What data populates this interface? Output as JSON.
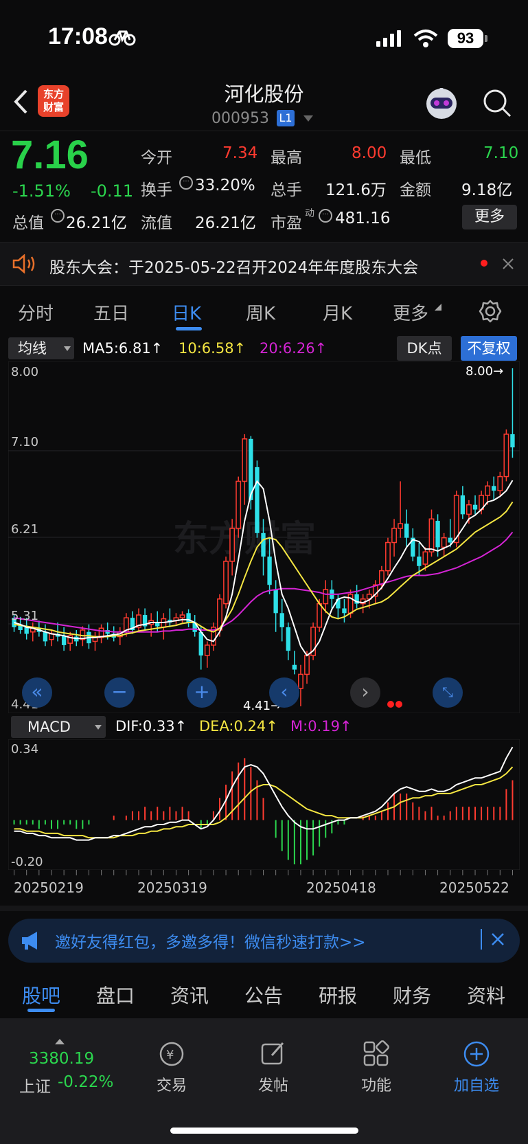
{
  "status": {
    "time": "17:08",
    "battery": "93"
  },
  "header": {
    "logo_text": "东方财富",
    "title": "河化股份",
    "code": "000953",
    "level": "L1"
  },
  "quote": {
    "price": "7.16",
    "change_pct": "-1.51%",
    "change": "-0.11",
    "open_label": "今开",
    "open": "7.34",
    "high_label": "最高",
    "high": "8.00",
    "low_label": "最低",
    "low": "7.10",
    "turnover_label": "换手",
    "turnover": "33.20%",
    "volume_label": "总手",
    "volume": "121.6万",
    "amount_label": "金额",
    "amount": "9.18亿",
    "mktcap_label": "总值",
    "mktcap": "26.21亿",
    "float_label": "流值",
    "float": "26.21亿",
    "pe_label": "市盈",
    "pe_sup": "动",
    "pe": "481.16",
    "more_label": "更多"
  },
  "notice": {
    "text": "股东大会：于2025-05-22召开2024年年度股东大会"
  },
  "chart_tabs": [
    "分时",
    "五日",
    "日K",
    "周K",
    "月K",
    "更多"
  ],
  "active_chart_tab": "日K",
  "ma_bar": {
    "select": "均线",
    "ma5": "MA5:6.81↑",
    "ma10": "10:6.58↑",
    "ma20": "20:6.26↑",
    "dk_label": "DK点",
    "fq_label": "不复权"
  },
  "price_axis": {
    "top": "8.00",
    "l2": "7.10",
    "l3": "6.21",
    "l4": "5.31",
    "bottom": "4.41"
  },
  "annotations": {
    "max": "8.00→",
    "min": "4.41→"
  },
  "watermark": "东方财富",
  "macd_bar": {
    "select": "MACD",
    "dif": "DIF:0.33↑",
    "dea": "DEA:0.24↑",
    "m": "M:0.19↑"
  },
  "macd_axis": {
    "top": "0.34",
    "bottom": "-0.20"
  },
  "dates": [
    "20250219",
    "20250319",
    "20250418",
    "20250522"
  ],
  "invite": {
    "text": "邀好友得红包，多邀多得！微信秒速打款>>"
  },
  "footer_tabs": [
    "股吧",
    "盘口",
    "资讯",
    "公告",
    "研报",
    "财务",
    "资料"
  ],
  "active_footer_tab": "股吧",
  "bottom_nav": {
    "index_value": "3380.19",
    "index_name": "上证",
    "index_change": "-0.22%",
    "trade": "交易",
    "post": "发帖",
    "func": "功能",
    "add": "加自选"
  },
  "colors": {
    "up": "#ff3b30",
    "down": "#2ee0e8",
    "ma5": "#ffffff",
    "ma10": "#f5e642",
    "ma20": "#d424d4",
    "accent": "#2d7fe0"
  },
  "chart_data": {
    "type": "candlestick",
    "ylim": [
      4.41,
      8.0
    ],
    "ohlc": [
      [
        5.35,
        5.38,
        5.2,
        5.25
      ],
      [
        5.28,
        5.36,
        5.18,
        5.22
      ],
      [
        5.25,
        5.35,
        5.12,
        5.18
      ],
      [
        5.2,
        5.3,
        5.1,
        5.24
      ],
      [
        5.24,
        5.32,
        5.15,
        5.2
      ],
      [
        5.2,
        5.28,
        5.05,
        5.1
      ],
      [
        5.12,
        5.22,
        5.05,
        5.18
      ],
      [
        5.18,
        5.3,
        5.1,
        5.15
      ],
      [
        5.16,
        5.25,
        5.0,
        5.06
      ],
      [
        5.08,
        5.2,
        5.0,
        5.16
      ],
      [
        5.15,
        5.22,
        5.05,
        5.1
      ],
      [
        5.12,
        5.26,
        5.05,
        5.22
      ],
      [
        5.2,
        5.28,
        5.02,
        5.08
      ],
      [
        5.1,
        5.2,
        5.0,
        5.15
      ],
      [
        5.14,
        5.28,
        5.08,
        5.24
      ],
      [
        5.22,
        5.3,
        5.12,
        5.18
      ],
      [
        5.18,
        5.26,
        5.1,
        5.14
      ],
      [
        5.15,
        5.25,
        5.06,
        5.2
      ],
      [
        5.2,
        5.4,
        5.15,
        5.35
      ],
      [
        5.35,
        5.42,
        5.18,
        5.22
      ],
      [
        5.25,
        5.45,
        5.2,
        5.38
      ],
      [
        5.38,
        5.45,
        5.22,
        5.26
      ],
      [
        5.28,
        5.4,
        5.15,
        5.32
      ],
      [
        5.3,
        5.42,
        5.2,
        5.26
      ],
      [
        5.25,
        5.4,
        5.12,
        5.34
      ],
      [
        5.33,
        5.45,
        5.25,
        5.3
      ],
      [
        5.32,
        5.4,
        5.28,
        5.35
      ],
      [
        5.35,
        5.42,
        5.3,
        5.38
      ],
      [
        5.4,
        5.44,
        5.25,
        5.3
      ],
      [
        5.3,
        5.38,
        5.15,
        5.2
      ],
      [
        5.2,
        5.26,
        4.8,
        4.95
      ],
      [
        4.95,
        5.1,
        4.82,
        5.06
      ],
      [
        5.06,
        5.3,
        5.0,
        5.25
      ],
      [
        5.22,
        5.6,
        5.15,
        5.55
      ],
      [
        5.5,
        6.0,
        5.45,
        5.95
      ],
      [
        5.95,
        6.4,
        5.8,
        6.3
      ],
      [
        6.3,
        6.85,
        6.2,
        6.8
      ],
      [
        6.8,
        7.3,
        6.55,
        7.25
      ],
      [
        7.25,
        7.28,
        6.5,
        6.6
      ],
      [
        6.95,
        7.02,
        6.2,
        6.25
      ],
      [
        6.25,
        6.4,
        5.8,
        6.0
      ],
      [
        6.0,
        6.2,
        5.6,
        5.7
      ],
      [
        5.65,
        5.75,
        5.2,
        5.4
      ],
      [
        5.4,
        5.55,
        5.1,
        5.25
      ],
      [
        5.25,
        5.3,
        4.9,
        5.0
      ],
      [
        4.85,
        5.0,
        4.75,
        4.8
      ],
      [
        4.6,
        4.85,
        4.41,
        4.75
      ],
      [
        4.75,
        5.0,
        4.65,
        4.95
      ],
      [
        4.95,
        5.3,
        4.9,
        5.25
      ],
      [
        5.25,
        5.55,
        5.2,
        5.5
      ],
      [
        5.5,
        5.75,
        5.4,
        5.65
      ],
      [
        5.65,
        5.75,
        5.45,
        5.55
      ],
      [
        5.55,
        5.6,
        5.35,
        5.45
      ],
      [
        5.45,
        5.55,
        5.3,
        5.4
      ],
      [
        5.4,
        5.65,
        5.35,
        5.6
      ],
      [
        5.6,
        5.7,
        5.45,
        5.5
      ],
      [
        5.5,
        5.6,
        5.4,
        5.55
      ],
      [
        5.55,
        5.65,
        5.45,
        5.6
      ],
      [
        5.58,
        5.75,
        5.5,
        5.7
      ],
      [
        5.7,
        5.9,
        5.65,
        5.85
      ],
      [
        5.85,
        6.2,
        5.8,
        6.15
      ],
      [
        6.15,
        6.4,
        6.0,
        6.3
      ],
      [
        6.3,
        6.8,
        6.2,
        6.35
      ],
      [
        6.35,
        6.5,
        6.1,
        6.2
      ],
      [
        6.2,
        6.3,
        5.95,
        6.0
      ],
      [
        6.0,
        6.15,
        5.8,
        5.9
      ],
      [
        5.92,
        6.1,
        5.85,
        6.05
      ],
      [
        6.05,
        6.5,
        6.0,
        6.4
      ],
      [
        6.38,
        6.45,
        6.0,
        6.1
      ],
      [
        6.1,
        6.25,
        6.0,
        6.2
      ],
      [
        6.2,
        6.4,
        6.1,
        6.15
      ],
      [
        6.15,
        6.7,
        6.1,
        6.65
      ],
      [
        6.65,
        6.75,
        6.4,
        6.45
      ],
      [
        6.45,
        6.6,
        6.35,
        6.55
      ],
      [
        6.55,
        6.65,
        6.45,
        6.5
      ],
      [
        6.5,
        6.7,
        6.45,
        6.65
      ],
      [
        6.65,
        6.8,
        6.55,
        6.75
      ],
      [
        6.75,
        6.85,
        6.6,
        6.7
      ],
      [
        6.7,
        6.9,
        6.65,
        6.85
      ],
      [
        6.85,
        7.35,
        6.8,
        7.3
      ],
      [
        7.3,
        8.0,
        7.05,
        7.16
      ]
    ],
    "ma5": [
      5.3,
      5.28,
      5.25,
      5.24,
      5.22,
      5.2,
      5.18,
      5.17,
      5.16,
      5.14,
      5.13,
      5.13,
      5.14,
      5.14,
      5.15,
      5.16,
      5.17,
      5.18,
      5.22,
      5.24,
      5.27,
      5.28,
      5.3,
      5.3,
      5.3,
      5.31,
      5.32,
      5.33,
      5.33,
      5.3,
      5.2,
      5.12,
      5.1,
      5.2,
      5.36,
      5.6,
      5.97,
      6.38,
      6.66,
      6.8,
      6.72,
      6.38,
      5.95,
      5.6,
      5.45,
      5.25,
      5.05,
      4.95,
      5.0,
      5.1,
      5.27,
      5.44,
      5.55,
      5.57,
      5.56,
      5.52,
      5.51,
      5.54,
      5.6,
      5.67,
      5.77,
      5.88,
      5.98,
      6.1,
      6.18,
      6.16,
      6.08,
      6.08,
      6.06,
      6.09,
      6.12,
      6.2,
      6.3,
      6.4,
      6.44,
      6.5,
      6.58,
      6.6,
      6.64,
      6.7,
      6.81
    ],
    "ma10": [
      5.28,
      5.27,
      5.26,
      5.25,
      5.24,
      5.23,
      5.22,
      5.2,
      5.19,
      5.18,
      5.17,
      5.16,
      5.16,
      5.15,
      5.15,
      5.15,
      5.16,
      5.16,
      5.18,
      5.19,
      5.21,
      5.22,
      5.23,
      5.24,
      5.25,
      5.26,
      5.27,
      5.29,
      5.3,
      5.3,
      5.26,
      5.22,
      5.2,
      5.24,
      5.33,
      5.44,
      5.6,
      5.78,
      5.95,
      6.1,
      6.18,
      6.2,
      6.18,
      6.1,
      6.0,
      5.9,
      5.8,
      5.7,
      5.6,
      5.5,
      5.42,
      5.36,
      5.34,
      5.36,
      5.4,
      5.44,
      5.46,
      5.48,
      5.5,
      5.52,
      5.56,
      5.62,
      5.68,
      5.74,
      5.8,
      5.84,
      5.88,
      5.92,
      5.96,
      6.0,
      6.04,
      6.08,
      6.14,
      6.2,
      6.26,
      6.3,
      6.34,
      6.38,
      6.42,
      6.48,
      6.58
    ],
    "ma20": [
      5.35,
      5.34,
      5.33,
      5.32,
      5.31,
      5.3,
      5.29,
      5.28,
      5.27,
      5.26,
      5.25,
      5.24,
      5.23,
      5.22,
      5.21,
      5.21,
      5.2,
      5.2,
      5.2,
      5.2,
      5.2,
      5.2,
      5.2,
      5.2,
      5.21,
      5.21,
      5.22,
      5.22,
      5.23,
      5.23,
      5.22,
      5.22,
      5.22,
      5.24,
      5.28,
      5.32,
      5.38,
      5.45,
      5.52,
      5.58,
      5.62,
      5.64,
      5.65,
      5.66,
      5.66,
      5.66,
      5.65,
      5.64,
      5.63,
      5.62,
      5.6,
      5.6,
      5.6,
      5.61,
      5.62,
      5.63,
      5.65,
      5.67,
      5.69,
      5.71,
      5.73,
      5.75,
      5.77,
      5.79,
      5.8,
      5.8,
      5.8,
      5.81,
      5.82,
      5.84,
      5.86,
      5.88,
      5.91,
      5.94,
      5.97,
      6.0,
      6.04,
      6.08,
      6.12,
      6.18,
      6.26
    ],
    "macd_ylim": [
      -0.2,
      0.34
    ],
    "dif": [
      -0.05,
      -0.05,
      -0.06,
      -0.06,
      -0.07,
      -0.07,
      -0.08,
      -0.08,
      -0.08,
      -0.08,
      -0.09,
      -0.09,
      -0.09,
      -0.08,
      -0.08,
      -0.08,
      -0.07,
      -0.07,
      -0.06,
      -0.05,
      -0.04,
      -0.03,
      -0.03,
      -0.02,
      -0.02,
      -0.01,
      -0.01,
      0.0,
      0.0,
      -0.02,
      -0.04,
      -0.03,
      0.0,
      0.04,
      0.09,
      0.15,
      0.2,
      0.24,
      0.25,
      0.24,
      0.21,
      0.16,
      0.11,
      0.06,
      0.02,
      -0.01,
      -0.03,
      -0.04,
      -0.04,
      -0.03,
      -0.02,
      -0.01,
      0.0,
      0.0,
      0.01,
      0.01,
      0.02,
      0.03,
      0.04,
      0.06,
      0.09,
      0.12,
      0.14,
      0.15,
      0.14,
      0.13,
      0.13,
      0.14,
      0.13,
      0.13,
      0.14,
      0.16,
      0.17,
      0.18,
      0.19,
      0.19,
      0.2,
      0.21,
      0.22,
      0.28,
      0.33
    ],
    "dea": [
      -0.04,
      -0.04,
      -0.05,
      -0.05,
      -0.05,
      -0.06,
      -0.06,
      -0.06,
      -0.07,
      -0.07,
      -0.07,
      -0.07,
      -0.08,
      -0.08,
      -0.08,
      -0.08,
      -0.08,
      -0.07,
      -0.07,
      -0.07,
      -0.06,
      -0.06,
      -0.05,
      -0.05,
      -0.04,
      -0.04,
      -0.03,
      -0.03,
      -0.02,
      -0.02,
      -0.02,
      -0.02,
      -0.02,
      -0.01,
      0.01,
      0.04,
      0.07,
      0.1,
      0.13,
      0.15,
      0.16,
      0.16,
      0.15,
      0.13,
      0.11,
      0.09,
      0.07,
      0.05,
      0.04,
      0.03,
      0.02,
      0.02,
      0.01,
      0.01,
      0.01,
      0.01,
      0.01,
      0.02,
      0.03,
      0.04,
      0.05,
      0.06,
      0.08,
      0.09,
      0.1,
      0.1,
      0.11,
      0.11,
      0.12,
      0.12,
      0.12,
      0.13,
      0.14,
      0.15,
      0.16,
      0.16,
      0.17,
      0.18,
      0.19,
      0.21,
      0.24
    ]
  }
}
